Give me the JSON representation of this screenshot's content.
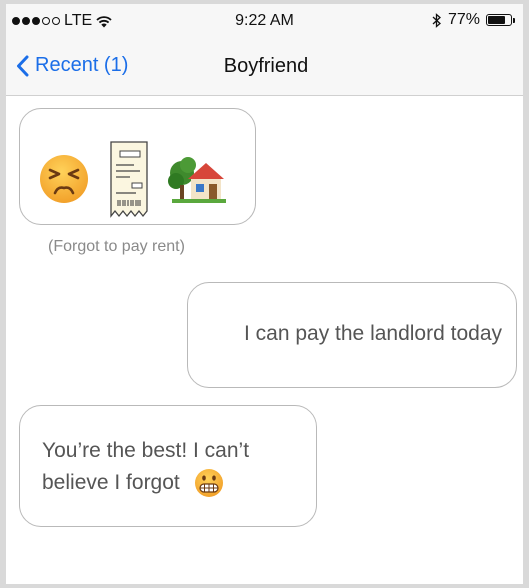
{
  "status_bar": {
    "carrier": "LTE",
    "time": "9:22 AM",
    "battery_percent": "77%",
    "battery_level": 0.77,
    "signal_bars": 3,
    "signal_total": 5,
    "icons": [
      "wifi-icon",
      "bluetooth-icon",
      "battery-icon"
    ]
  },
  "nav": {
    "back_label": "Recent (1)",
    "title": "Boyfriend",
    "accent_color": "#1b6ee8"
  },
  "messages": [
    {
      "side": "left",
      "emojis": [
        "persevering-face-emoji",
        "receipt-emoji",
        "house-with-garden-emoji"
      ],
      "caption": "(Forgot to pay rent)"
    },
    {
      "side": "right",
      "text": "I can pay the landlord today"
    },
    {
      "side": "left",
      "line1": "You’re the best! I can’t",
      "line2": "believe I forgot",
      "emoji": "grimacing-face-emoji"
    }
  ]
}
